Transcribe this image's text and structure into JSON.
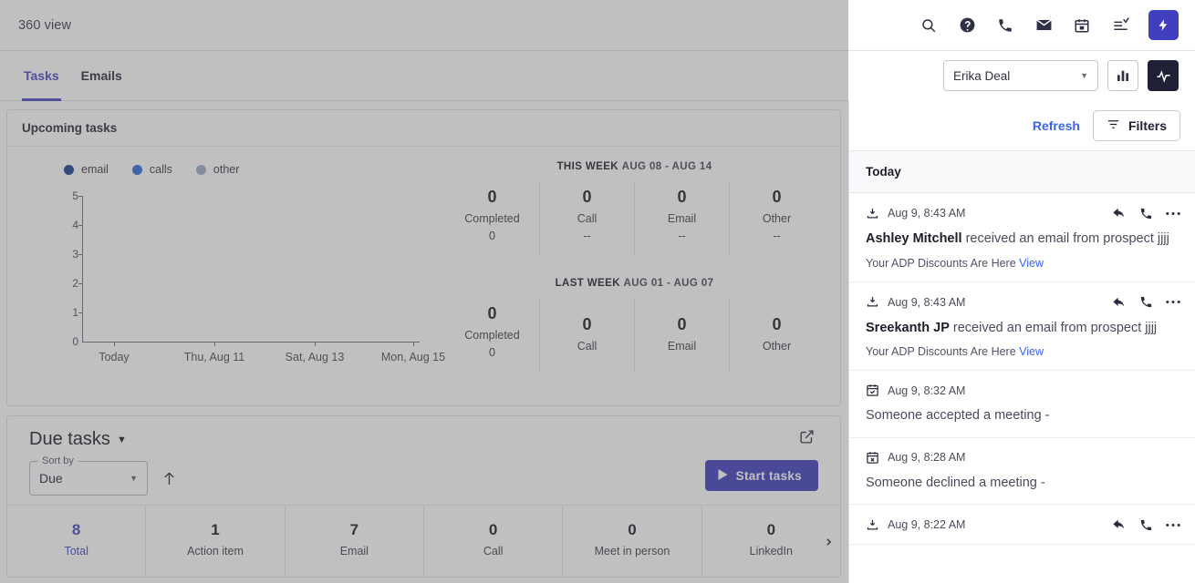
{
  "appbar": {
    "title": "360 view",
    "icons": [
      {
        "name": "search-icon"
      },
      {
        "name": "help-icon"
      },
      {
        "name": "phone-icon"
      },
      {
        "name": "email-icon"
      },
      {
        "name": "calendar-icon"
      },
      {
        "name": "tasklist-icon"
      }
    ],
    "action_button": "lightning-bolt"
  },
  "tabs": [
    {
      "label": "Tasks",
      "active": true
    },
    {
      "label": "Emails",
      "active": false
    }
  ],
  "toolbar": {
    "owner": "Erika Deal",
    "chart_button": "bar-chart-icon",
    "activity_button": "pulse-icon"
  },
  "upcoming": {
    "title": "Upcoming tasks",
    "legend": [
      {
        "label": "email",
        "color": "#1b3f8f"
      },
      {
        "label": "calls",
        "color": "#2c6ee0"
      },
      {
        "label": "other",
        "color": "#9bafcb"
      }
    ],
    "this_week": {
      "heading": "THIS WEEK",
      "range": "AUG 08 - AUG 14",
      "cells": [
        {
          "num": "0",
          "label": "Completed",
          "sub": "0"
        },
        {
          "num": "0",
          "label": "Call",
          "sub": "--"
        },
        {
          "num": "0",
          "label": "Email",
          "sub": "--"
        },
        {
          "num": "0",
          "label": "Other",
          "sub": "--"
        }
      ]
    },
    "last_week": {
      "heading": "LAST WEEK",
      "range": "AUG 01 - AUG 07",
      "cells": [
        {
          "num": "0",
          "label": "Completed",
          "sub": "0"
        },
        {
          "num": "0",
          "label": "Call",
          "sub": ""
        },
        {
          "num": "0",
          "label": "Email",
          "sub": ""
        },
        {
          "num": "0",
          "label": "Other",
          "sub": ""
        }
      ]
    }
  },
  "chart_data": {
    "type": "line",
    "title": "Upcoming tasks",
    "xlabel": "",
    "ylabel": "",
    "ylim": [
      0,
      5
    ],
    "yticks": [
      "0",
      "1",
      "2",
      "3",
      "4",
      "5"
    ],
    "x": [
      "Today",
      "Thu, Aug 11",
      "Sat, Aug 13",
      "Mon, Aug 15"
    ],
    "xticks": [
      "Today",
      "Thu, Aug 11",
      "Sat, Aug 13",
      "Mon, Aug 15"
    ],
    "grid": false,
    "legend_position": "top-left",
    "series": [
      {
        "name": "email",
        "color": "#1b3f8f",
        "values": [
          0,
          0,
          0,
          0
        ]
      },
      {
        "name": "calls",
        "color": "#2c6ee0",
        "values": [
          0,
          0,
          0,
          0
        ]
      },
      {
        "name": "other",
        "color": "#9bafcb",
        "values": [
          0,
          0,
          0,
          0
        ]
      }
    ]
  },
  "due": {
    "title": "Due tasks",
    "sort_label": "Sort by",
    "sort_value": "Due",
    "sort_direction": "ascending",
    "start_button": "Start tasks",
    "expand_icon": "external-link-icon",
    "counters": [
      {
        "num": "8",
        "label": "Total",
        "active": true
      },
      {
        "num": "1",
        "label": "Action item",
        "active": false
      },
      {
        "num": "7",
        "label": "Email",
        "active": false
      },
      {
        "num": "0",
        "label": "Call",
        "active": false
      },
      {
        "num": "0",
        "label": "Meet in person",
        "active": false
      },
      {
        "num": "0",
        "label": "LinkedIn",
        "active": false
      }
    ]
  },
  "activity_panel": {
    "refresh": "Refresh",
    "filters": "Filters",
    "section": "Today",
    "items": [
      {
        "type_icon": "inbox-download-icon",
        "time": "Aug 9, 8:43 AM",
        "actor": "Ashley Mitchell",
        "text": " received an email from prospect jjjj",
        "subject": "Your ADP Discounts Are Here",
        "link": "View",
        "has_actions": true
      },
      {
        "type_icon": "inbox-download-icon",
        "time": "Aug 9, 8:43 AM",
        "actor": "Sreekanth JP",
        "text": " received an email from prospect jjjj",
        "subject": "Your ADP Discounts Are Here",
        "link": "View",
        "has_actions": true
      },
      {
        "type_icon": "calendar-check-icon",
        "time": "Aug 9, 8:32 AM",
        "actor": "",
        "text": "Someone accepted a meeting -",
        "subject": "",
        "link": "",
        "has_actions": false
      },
      {
        "type_icon": "calendar-x-icon",
        "time": "Aug 9, 8:28 AM",
        "actor": "",
        "text": "Someone declined a meeting -",
        "subject": "",
        "link": "",
        "has_actions": false
      },
      {
        "type_icon": "inbox-download-icon",
        "time": "Aug 9, 8:22 AM",
        "actor": "",
        "text": "",
        "subject": "",
        "link": "",
        "has_actions": true
      }
    ]
  },
  "colors": {
    "accent_purple": "#4040bf",
    "link_blue": "#3a63ee",
    "tab_active": "#4a4ac4"
  }
}
